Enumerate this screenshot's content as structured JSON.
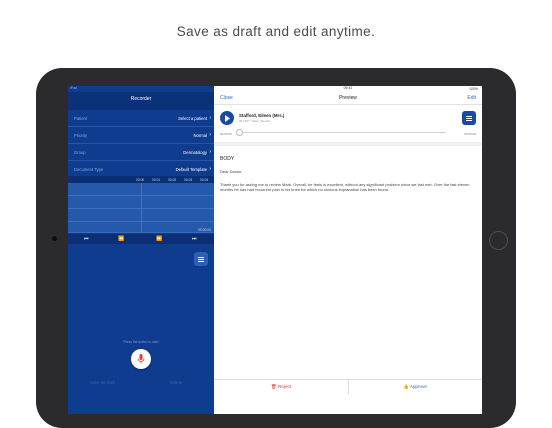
{
  "caption": "Save as draft and edit anytime.",
  "status": {
    "left": "iPad",
    "time": "09:41",
    "battery": "100%"
  },
  "recorder": {
    "title": "Recorder",
    "rows": [
      {
        "label": "Patient",
        "value": "Select a patient"
      },
      {
        "label": "Priority",
        "value": "Normal"
      },
      {
        "label": "Group",
        "value": "Dermatology"
      },
      {
        "label": "Document Type",
        "value": "Default Template"
      }
    ],
    "ticks": [
      "00:00",
      "00:01",
      "00:02",
      "00:03",
      "00:04"
    ],
    "timestamp": "00:00.00",
    "hint": "Press the button to start",
    "bottom_left": "Save as draft",
    "bottom_right": "Delete"
  },
  "preview": {
    "close_label": "Close",
    "title": "Preview",
    "edit_label": "Edit",
    "patient_name": "Stafford, Eileen (Mrs.)",
    "patient_meta": "05.2017 | Male | Benda",
    "time_start": "00:00:00",
    "time_end": "00:00:00",
    "heading": "BODY",
    "greeting": "Dear Doctor,",
    "body": "Thank you for asking me to review Mark.  Overall, he feels is excellent, without any significant problem since we last met. Over the last eleven months he has had recurrent pain in his knee for which no obvious explanation has been found.",
    "reject_label": "Reject",
    "approve_label": "Approve"
  },
  "colors": {
    "panel": "#0f3c8f",
    "accent": "#2a68c9",
    "reject": "#d9392f",
    "playhead": "#e03c3c"
  }
}
